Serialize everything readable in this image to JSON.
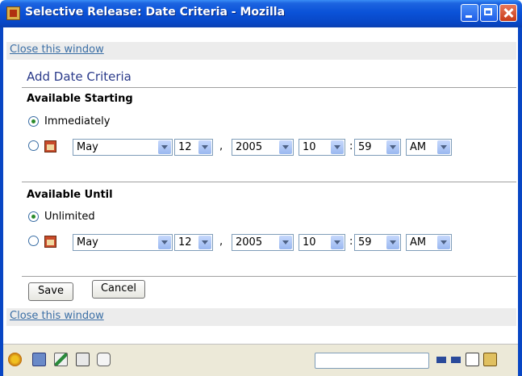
{
  "window": {
    "title": "Selective Release: Date Criteria - Mozilla"
  },
  "links": {
    "close_top": "Close this window",
    "close_bottom": "Close this window"
  },
  "heading": "Add Date Criteria",
  "starting": {
    "title": "Available Starting",
    "option_immediately": "Immediately",
    "date": {
      "month": "May",
      "day": "12",
      "year": "2005",
      "hour": "10",
      "minute": "59",
      "ampm": "AM"
    }
  },
  "until": {
    "title": "Available Until",
    "option_unlimited": "Unlimited",
    "date": {
      "month": "May",
      "day": "12",
      "year": "2005",
      "hour": "10",
      "minute": "59",
      "ampm": "AM"
    }
  },
  "separators": {
    "comma": ",",
    "colon": ":"
  },
  "buttons": {
    "save": "Save",
    "cancel": "Cancel"
  },
  "icons": {
    "title": "mozilla-app-icon",
    "calendar": "calendar-icon",
    "status": [
      "navigator-icon",
      "mail-icon",
      "composer-icon",
      "address-book-icon",
      "irc-chat-icon"
    ],
    "status_right": [
      "online-plug-icon",
      "security-icon",
      "padlock-icon"
    ]
  }
}
